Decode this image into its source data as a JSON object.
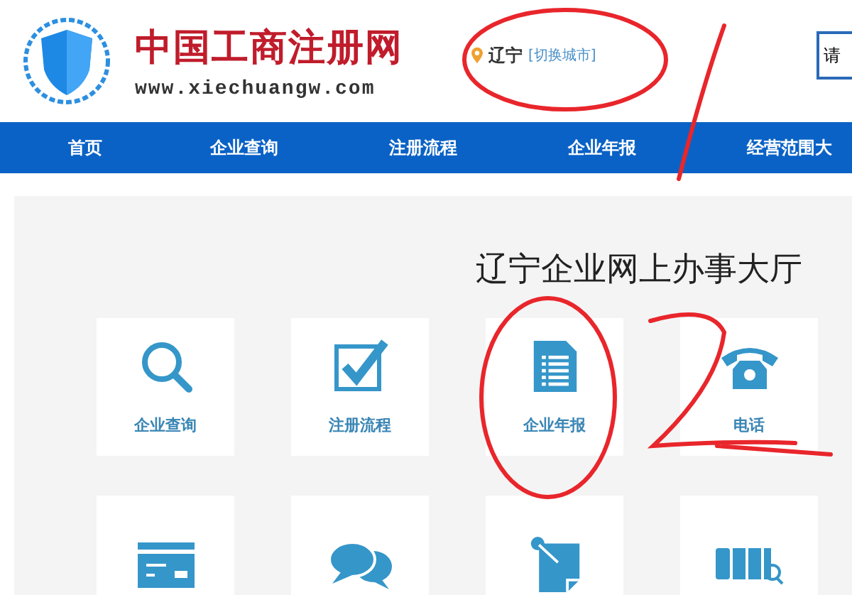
{
  "header": {
    "site_name": "中国工商注册网",
    "site_url": "www.xiechuangw.com",
    "location": "辽宁",
    "switch_city": "[切换城市]",
    "search": {
      "placeholder": "请"
    }
  },
  "nav": [
    {
      "label": "首页"
    },
    {
      "label": "企业查询"
    },
    {
      "label": "注册流程"
    },
    {
      "label": "企业年报"
    },
    {
      "label": "经营范围大"
    }
  ],
  "hall": {
    "title": "辽宁企业网上办事大厅",
    "tiles": [
      {
        "kind": "search",
        "label": "企业查询"
      },
      {
        "kind": "check",
        "label": "注册流程"
      },
      {
        "kind": "document",
        "label": "企业年报"
      },
      {
        "kind": "phone",
        "label": "电话"
      },
      {
        "kind": "card"
      },
      {
        "kind": "chat"
      },
      {
        "kind": "note"
      },
      {
        "kind": "shelf"
      }
    ]
  }
}
